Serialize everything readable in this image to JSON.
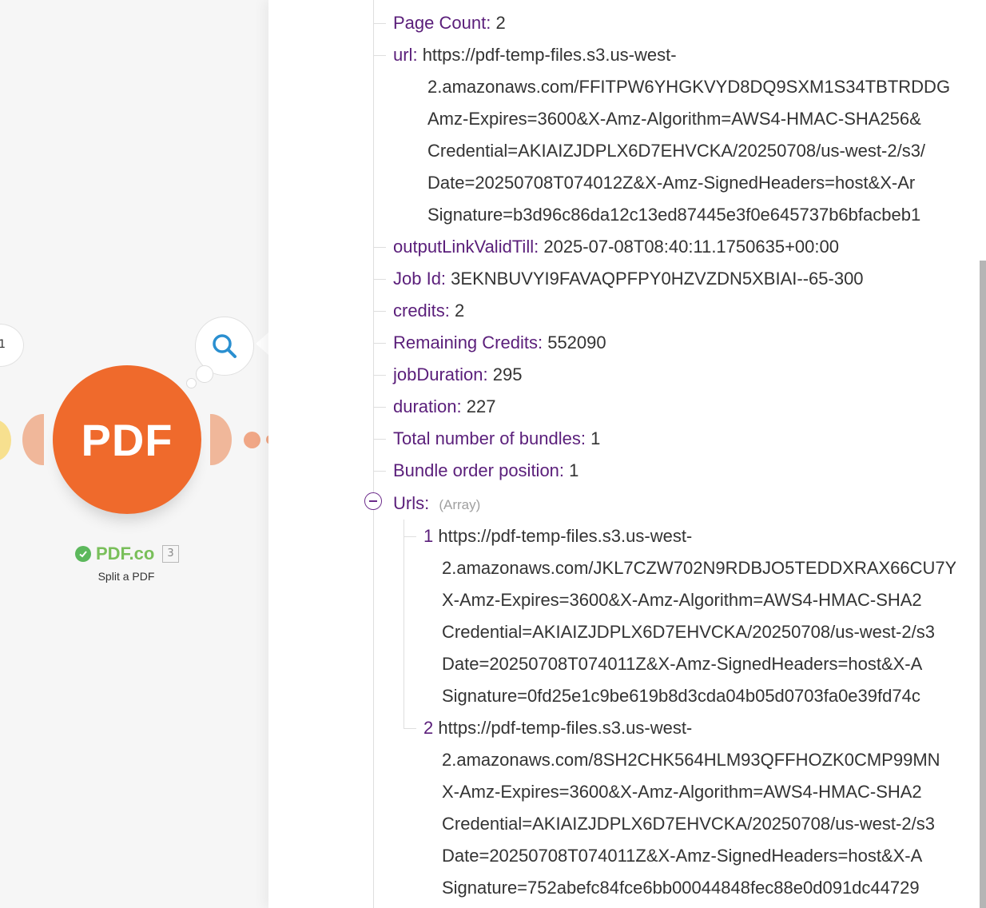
{
  "module": {
    "icon_text": "PDF",
    "name": "PDF.co",
    "count": "3",
    "subtitle": "Split a PDF",
    "prev_node_label": "1",
    "brand_color": "#ef6a2c",
    "status_color": "#5cb85c"
  },
  "output": {
    "fields": [
      {
        "key": "Page Count:",
        "lines": [
          "2"
        ]
      },
      {
        "key": "url:",
        "lines": [
          "https://pdf-temp-files.s3.us-west-",
          "2.amazonaws.com/FFITPW6YHGKVYD8DQ9SXM1S34TBTRDDG",
          "Amz-Expires=3600&X-Amz-Algorithm=AWS4-HMAC-SHA256&",
          "Credential=AKIAIZJDPLX6D7EHVCKA/20250708/us-west-2/s3/",
          "Date=20250708T074012Z&X-Amz-SignedHeaders=host&X-Ar",
          "Signature=b3d96c86da12c13ed87445e3f0e645737b6bfacbeb1"
        ]
      },
      {
        "key": "outputLinkValidTill:",
        "lines": [
          "2025-07-08T08:40:11.1750635+00:00"
        ]
      },
      {
        "key": "Job Id:",
        "lines": [
          "3EKNBUVYI9FAVAQPFPY0HZVZDN5XBIAI--65-300"
        ]
      },
      {
        "key": "credits:",
        "lines": [
          "2"
        ]
      },
      {
        "key": "Remaining Credits:",
        "lines": [
          "552090"
        ]
      },
      {
        "key": "jobDuration:",
        "lines": [
          "295"
        ]
      },
      {
        "key": "duration:",
        "lines": [
          "227"
        ]
      },
      {
        "key": "Total number of bundles:",
        "lines": [
          "1"
        ]
      },
      {
        "key": "Bundle order position:",
        "lines": [
          "1"
        ]
      }
    ],
    "urls": {
      "key": "Urls:",
      "type_label": "(Array)",
      "items": [
        {
          "index": "1",
          "lines": [
            "https://pdf-temp-files.s3.us-west-",
            "2.amazonaws.com/JKL7CZW702N9RDBJO5TEDDXRAX66CU7Y",
            "X-Amz-Expires=3600&X-Amz-Algorithm=AWS4-HMAC-SHA2",
            "Credential=AKIAIZJDPLX6D7EHVCKA/20250708/us-west-2/s3",
            "Date=20250708T074011Z&X-Amz-SignedHeaders=host&X-A",
            "Signature=0fd25e1c9be619b8d3cda04b05d0703fa0e39fd74c"
          ]
        },
        {
          "index": "2",
          "lines": [
            "https://pdf-temp-files.s3.us-west-",
            "2.amazonaws.com/8SH2CHK564HLM93QFFHOZK0CMP99MN",
            "X-Amz-Expires=3600&X-Amz-Algorithm=AWS4-HMAC-SHA2",
            "Credential=AKIAIZJDPLX6D7EHVCKA/20250708/us-west-2/s3",
            "Date=20250708T074011Z&X-Amz-SignedHeaders=host&X-A",
            "Signature=752abefc84fce6bb00044848fec88e0d091dc44729"
          ]
        }
      ]
    }
  }
}
